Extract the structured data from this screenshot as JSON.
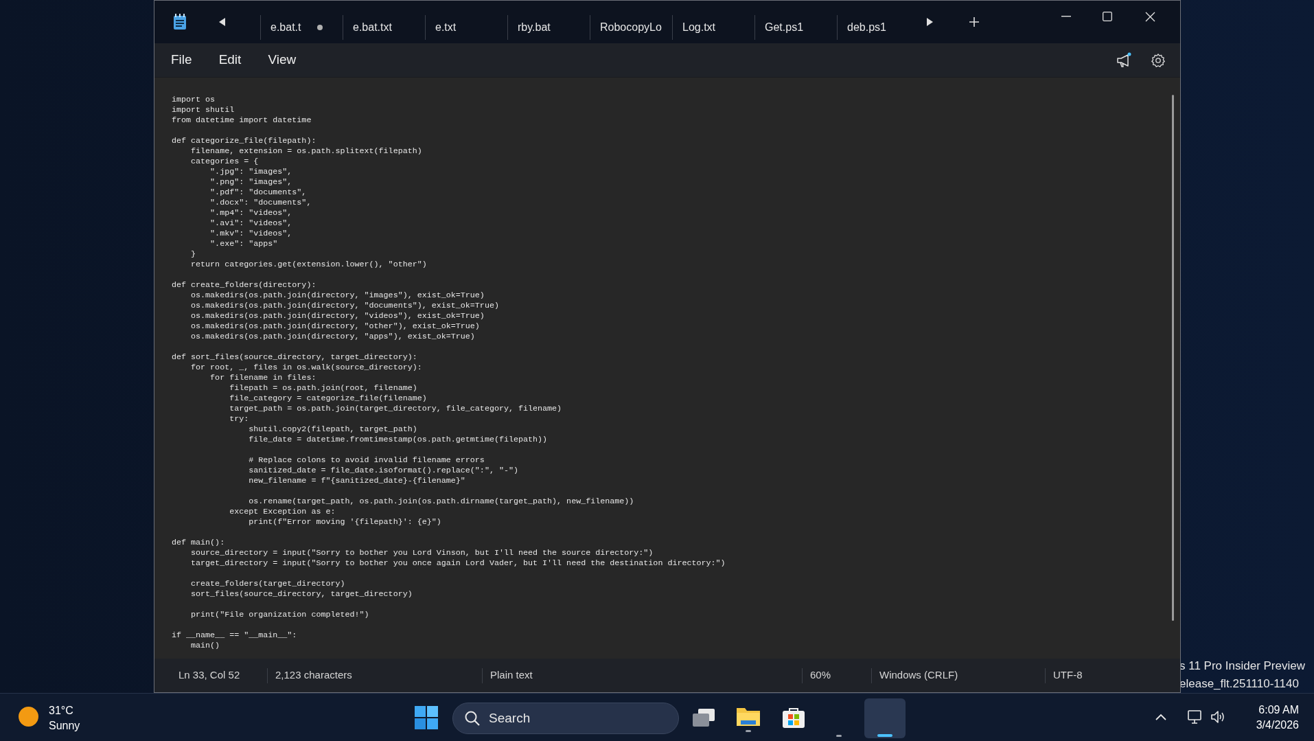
{
  "tabs": [
    {
      "label": "e.bat.t",
      "modified": true
    },
    {
      "label": "e.bat.txt",
      "modified": false
    },
    {
      "label": "e.txt",
      "modified": false
    },
    {
      "label": "rby.bat",
      "modified": false
    },
    {
      "label": "RobocopyLo",
      "modified": false
    },
    {
      "label": "Log.txt",
      "modified": false
    },
    {
      "label": "Get.ps1",
      "modified": false
    },
    {
      "label": "deb.ps1",
      "modified": false
    }
  ],
  "menu": [
    "File",
    "Edit",
    "View"
  ],
  "editor": {
    "code": "import os\nimport shutil\nfrom datetime import datetime\n\ndef categorize_file(filepath):\n    filename, extension = os.path.splitext(filepath)\n    categories = {\n        \".jpg\": \"images\",\n        \".png\": \"images\",\n        \".pdf\": \"documents\",\n        \".docx\": \"documents\",\n        \".mp4\": \"videos\",\n        \".avi\": \"videos\",\n        \".mkv\": \"videos\",\n        \".exe\": \"apps\"\n    }\n    return categories.get(extension.lower(), \"other\")\n\ndef create_folders(directory):\n    os.makedirs(os.path.join(directory, \"images\"), exist_ok=True)\n    os.makedirs(os.path.join(directory, \"documents\"), exist_ok=True)\n    os.makedirs(os.path.join(directory, \"videos\"), exist_ok=True)\n    os.makedirs(os.path.join(directory, \"other\"), exist_ok=True)\n    os.makedirs(os.path.join(directory, \"apps\"), exist_ok=True)\n\ndef sort_files(source_directory, target_directory):\n    for root, _, files in os.walk(source_directory):\n        for filename in files:\n            filepath = os.path.join(root, filename)\n            file_category = categorize_file(filename)\n            target_path = os.path.join(target_directory, file_category, filename)\n            try:\n                shutil.copy2(filepath, target_path)\n                file_date = datetime.fromtimestamp(os.path.getmtime(filepath))\n\n                # Replace colons to avoid invalid filename errors\n                sanitized_date = file_date.isoformat().replace(\":\", \"-\")\n                new_filename = f\"{sanitized_date}-{filename}\"\n\n                os.rename(target_path, os.path.join(os.path.dirname(target_path), new_filename))\n            except Exception as e:\n                print(f\"Error moving '{filepath}': {e}\")\n\ndef main():\n    source_directory = input(\"Sorry to bother you Lord Vinson, but I'll need the source directory:\")\n    target_directory = input(\"Sorry to bother you once again Lord Vader, but I'll need the destination directory:\")\n\n    create_folders(target_directory)\n    sort_files(source_directory, target_directory)\n\n    print(\"File organization completed!\")\n\nif __name__ == \"__main__\":\n    main()"
  },
  "status_bar": [
    "Ln 33, Col 52",
    "2,123 characters",
    "Plain text",
    "60%",
    "Windows (CRLF)",
    "UTF-8"
  ],
  "desktop": {
    "build_text": [
      "s 11 Pro Insider Preview",
      "elease_flt.251110-1140"
    ]
  },
  "taskbar": {
    "weather": {
      "temperature": "31°C",
      "condition": "Sunny"
    },
    "search": {
      "placeholder": "Search"
    },
    "clock": {
      "time": "6:09 AM",
      "date": "3/4/2026"
    }
  }
}
